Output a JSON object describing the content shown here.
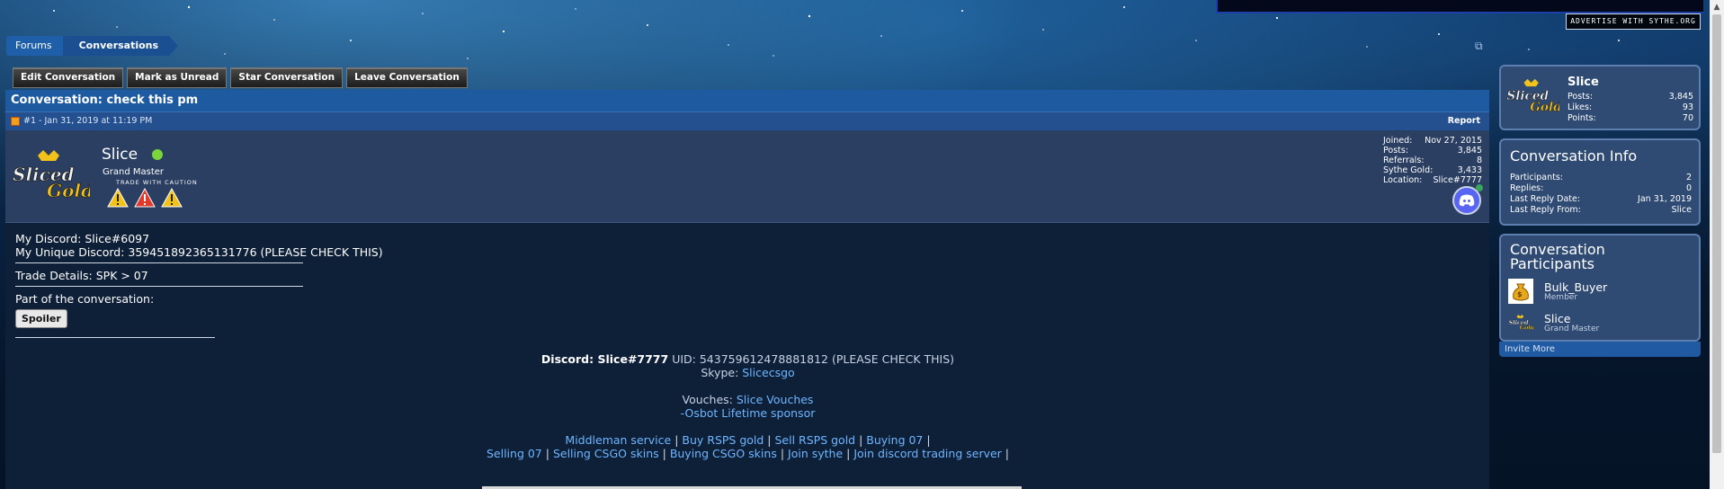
{
  "advertise": "ADVERTISE WITH SYTHE.ORG",
  "breadcrumb": [
    "Forums",
    "Conversations"
  ],
  "toolbar": {
    "edit": "Edit Conversation",
    "unread": "Mark as Unread",
    "star": "Star Conversation",
    "leave": "Leave Conversation"
  },
  "conversation": {
    "title": "Conversation: check this pm",
    "meta": "#1 - Jan 31, 2019 at 11:19 PM",
    "report": "Report"
  },
  "author": {
    "name": "Slice",
    "title": "Grand Master",
    "badge": "TRADE WITH CAUTION",
    "extra": [
      {
        "label": "Joined:",
        "value": "Nov 27, 2015"
      },
      {
        "label": "Posts:",
        "value": "3,845"
      },
      {
        "label": "Referrals:",
        "value": "8"
      },
      {
        "label": "Sythe Gold:",
        "value": "3,433"
      },
      {
        "label": "Location:",
        "value": "Slice#7777"
      }
    ]
  },
  "message": {
    "line1": "My Discord: Slice#6097",
    "line2": "My Unique Discord: 359451892365131776 (PLEASE CHECK THIS)",
    "line3": "Trade Details: SPK > 07",
    "line4": "Part of the conversation:",
    "spoiler": "Spoiler"
  },
  "signature": {
    "discord_label": "Discord: Slice#7777",
    "uid": " UID: 543759612478881812 (PLEASE CHECK THIS)",
    "skype_label": "Skype: ",
    "skype_link": "Slicecsgo",
    "vouches_label": "Vouches: ",
    "vouches_link": "Slice Vouches",
    "osbot": "-Osbot Lifetime sponsor",
    "links1": [
      "Middleman service",
      "Buy RSPS gold",
      "Sell RSPS gold",
      "Buying 07"
    ],
    "links2": [
      "Selling 07",
      "Selling CSGO skins",
      "Buying CSGO skins",
      "Join sythe",
      "Join discord trading server"
    ],
    "sep": " | "
  },
  "visitor": {
    "name": "Slice",
    "stats": [
      {
        "label": "Posts:",
        "value": "3,845"
      },
      {
        "label": "Likes:",
        "value": "93"
      },
      {
        "label": "Points:",
        "value": "70"
      }
    ]
  },
  "info": {
    "heading": "Conversation Info",
    "stats": [
      {
        "label": "Participants:",
        "value": "2"
      },
      {
        "label": "Replies:",
        "value": "0"
      },
      {
        "label": "Last Reply Date:",
        "value": "Jan 31, 2019"
      },
      {
        "label": "Last Reply From:",
        "value": "Slice"
      }
    ]
  },
  "participants": {
    "heading": "Conversation Participants",
    "list": [
      {
        "name": "Bulk_Buyer",
        "role": "Member"
      },
      {
        "name": "Slice",
        "role": "Grand Master"
      }
    ],
    "invite": "Invite More"
  },
  "logo_text": "SlicedGold",
  "colors": {
    "link": "#6fb6ff",
    "header": "#1e5aa0",
    "online": "#7ad43a",
    "warning": "#f2c21b",
    "danger": "#e23a2a"
  }
}
